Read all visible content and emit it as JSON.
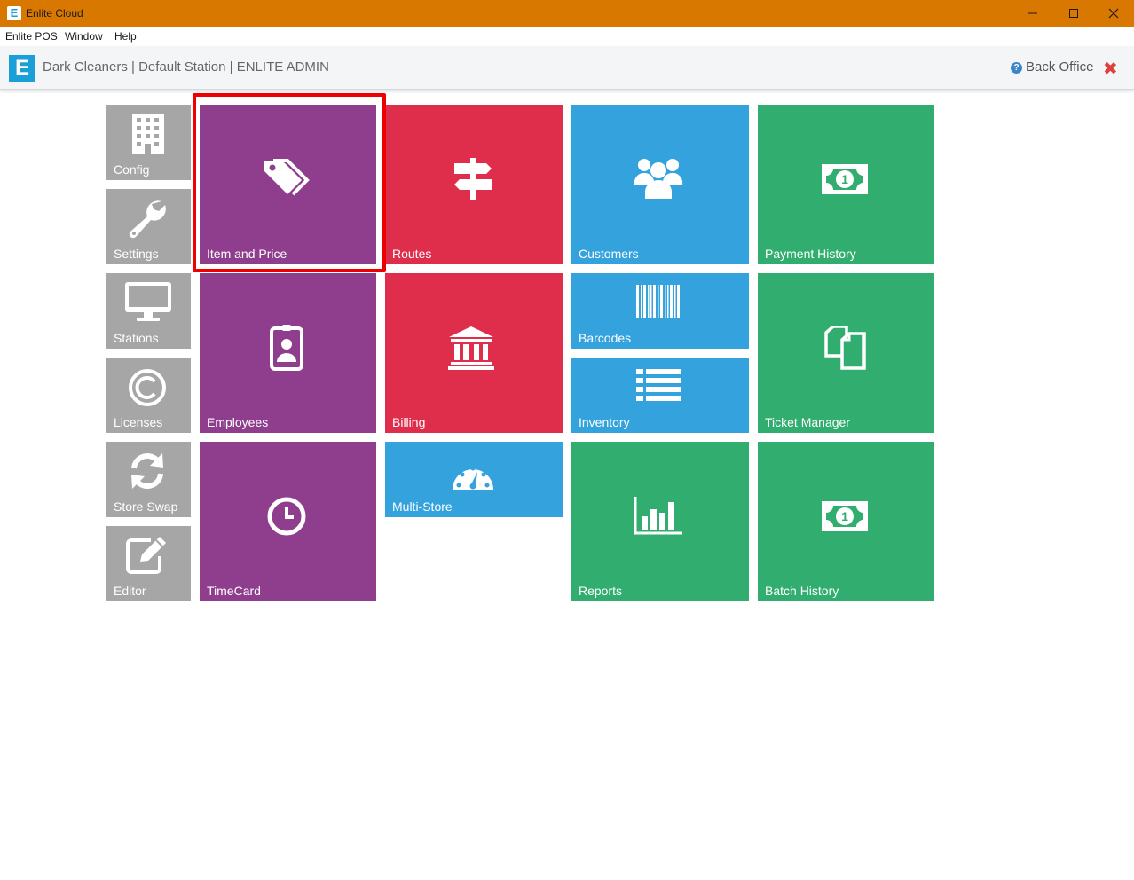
{
  "window": {
    "title": "Enlite Cloud",
    "app_icon": "E"
  },
  "menu": [
    "Enlite POS",
    "Window",
    "Help"
  ],
  "header": {
    "logo": "E",
    "store_info": "Dark Cleaners | Default Station | ENLITE ADMIN",
    "back_office": "Back Office",
    "help_glyph": "?",
    "close_glyph": "✖"
  },
  "tiles": {
    "config": "Config",
    "settings": "Settings",
    "stations": "Stations",
    "licenses": "Licenses",
    "store_swap": "Store Swap",
    "editor": "Editor",
    "item_and_price": "Item and Price",
    "employees": "Employees",
    "timecard": "TimeCard",
    "routes": "Routes",
    "billing": "Billing",
    "multi_store": "Multi-Store",
    "customers": "Customers",
    "barcodes": "Barcodes",
    "inventory": "Inventory",
    "reports": "Reports",
    "payment_history": "Payment History",
    "ticket_manager": "Ticket Manager",
    "batch_history": "Batch History"
  },
  "colors": {
    "titlebar": "#d97800",
    "gray": "#a6a6a6",
    "purple": "#8f3e8d",
    "red": "#df2e4c",
    "blue": "#33a2dd",
    "green": "#31ae6f",
    "highlight": "#ee0000"
  },
  "icons": {
    "config": "building-icon",
    "settings": "wrench-icon",
    "stations": "monitor-icon",
    "licenses": "copyright-icon",
    "store_swap": "refresh-icon",
    "editor": "edit-icon",
    "item_and_price": "tags-icon",
    "employees": "id-badge-icon",
    "timecard": "clock-icon",
    "routes": "signpost-icon",
    "billing": "bank-icon",
    "multi_store": "dashboard-icon",
    "customers": "users-icon",
    "barcodes": "barcode-icon",
    "inventory": "list-icon",
    "reports": "bar-chart-icon",
    "payment_history": "money-icon",
    "ticket_manager": "files-icon",
    "batch_history": "money-icon"
  }
}
